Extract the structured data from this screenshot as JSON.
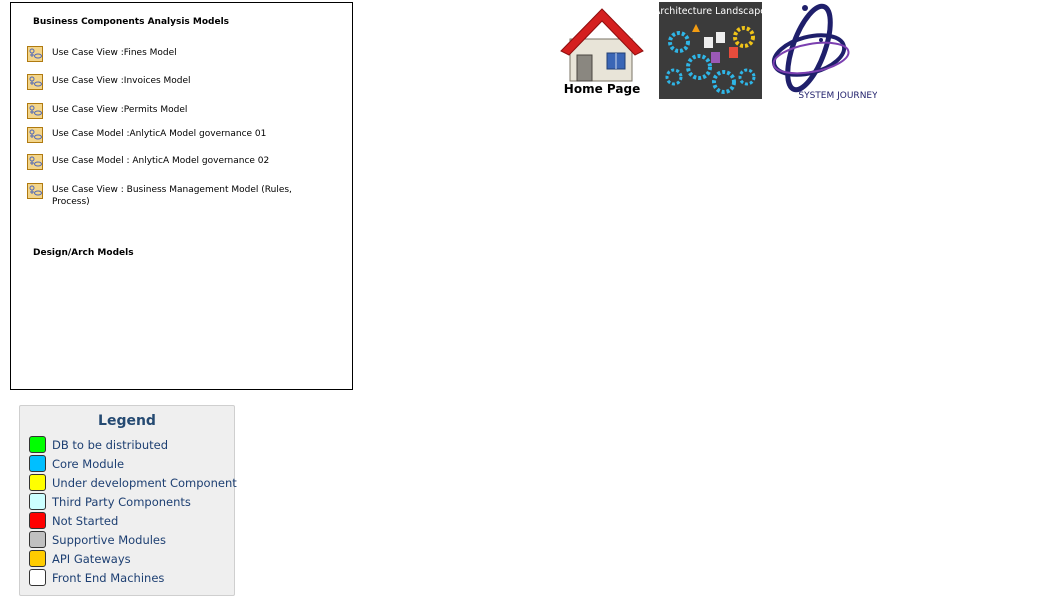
{
  "models_panel": {
    "business_title": "Business Components Analysis Models",
    "items": [
      {
        "label": "Use Case View :Fines Model"
      },
      {
        "label": "Use Case View :Invoices Model"
      },
      {
        "label": "Use Case View :Permits Model"
      },
      {
        "label": "Use Case Model :AnlyticA Model governance 01"
      },
      {
        "label": "Use Case Model : AnlyticA Model governance 02"
      },
      {
        "label": "Use Case View : Business Management Model (Rules, Process)"
      }
    ],
    "design_title": "Design/Arch Models"
  },
  "nav": {
    "home_label": "Home Page",
    "architecture_label": "Architecture Landscape",
    "journey_label": "SYSTEM JOURNEY"
  },
  "legend": {
    "title": "Legend",
    "items": [
      {
        "label": "DB to be distributed",
        "color": "#00ff00"
      },
      {
        "label": "Core Module",
        "color": "#00bfff"
      },
      {
        "label": "Under development Component",
        "color": "#ffff00"
      },
      {
        "label": "Third Party Components",
        "color": "#ccffff"
      },
      {
        "label": "Not Started",
        "color": "#ff0000"
      },
      {
        "label": "Supportive Modules",
        "color": "#c0c0c0"
      },
      {
        "label": "API Gateways",
        "color": "#ffcc00"
      },
      {
        "label": "Front End Machines",
        "color": "#ffffff"
      }
    ]
  }
}
